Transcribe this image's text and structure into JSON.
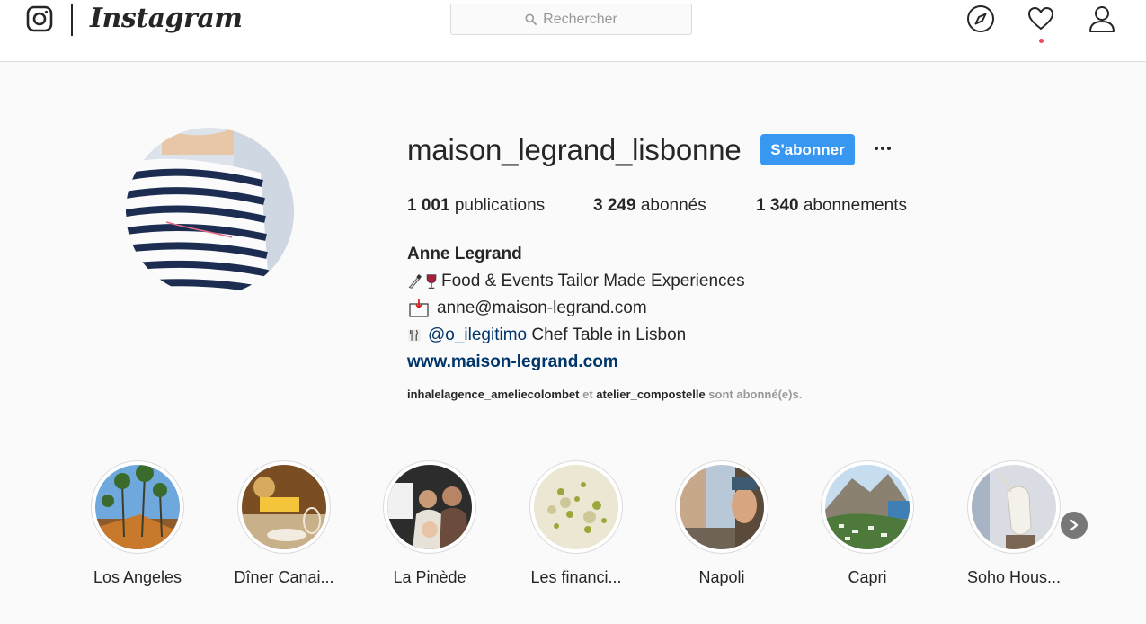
{
  "nav": {
    "brand": "Instagram",
    "search_placeholder": "Rechercher",
    "icons": [
      "instagram-glyph",
      "search-icon",
      "compass-icon",
      "heart-icon",
      "user-icon"
    ],
    "accent_dot_color": "#ed4956"
  },
  "profile": {
    "username": "maison_legrand_lisbonne",
    "follow_label": "S'abonner",
    "follow_color": "#3897f0",
    "stats": {
      "posts_count": "1 001",
      "posts_label": "publications",
      "followers_count": "3 249",
      "followers_label": "abonnés",
      "following_count": "1 340",
      "following_label": "abonnements"
    },
    "full_name": "Anne Legrand",
    "bio_line1": "Food & Events Tailor Made Experiences",
    "bio_email": "anne@maison-legrand.com",
    "bio_mention": "@o_ilegitimo",
    "bio_line3_rest": " Chef Table in Lisbon",
    "website": "www.maison-legrand.com",
    "followed_by_a": "inhalelagence_ameliecolombet",
    "followed_by_and": "et",
    "followed_by_b": "atelier_compostelle",
    "followed_by_suffix": "sont abonné(e)s."
  },
  "highlights": [
    {
      "label": "Los Angeles"
    },
    {
      "label": "Dîner Canai..."
    },
    {
      "label": "La Pinède"
    },
    {
      "label": "Les financi..."
    },
    {
      "label": "Napoli"
    },
    {
      "label": "Capri"
    },
    {
      "label": "Soho Hous..."
    }
  ]
}
